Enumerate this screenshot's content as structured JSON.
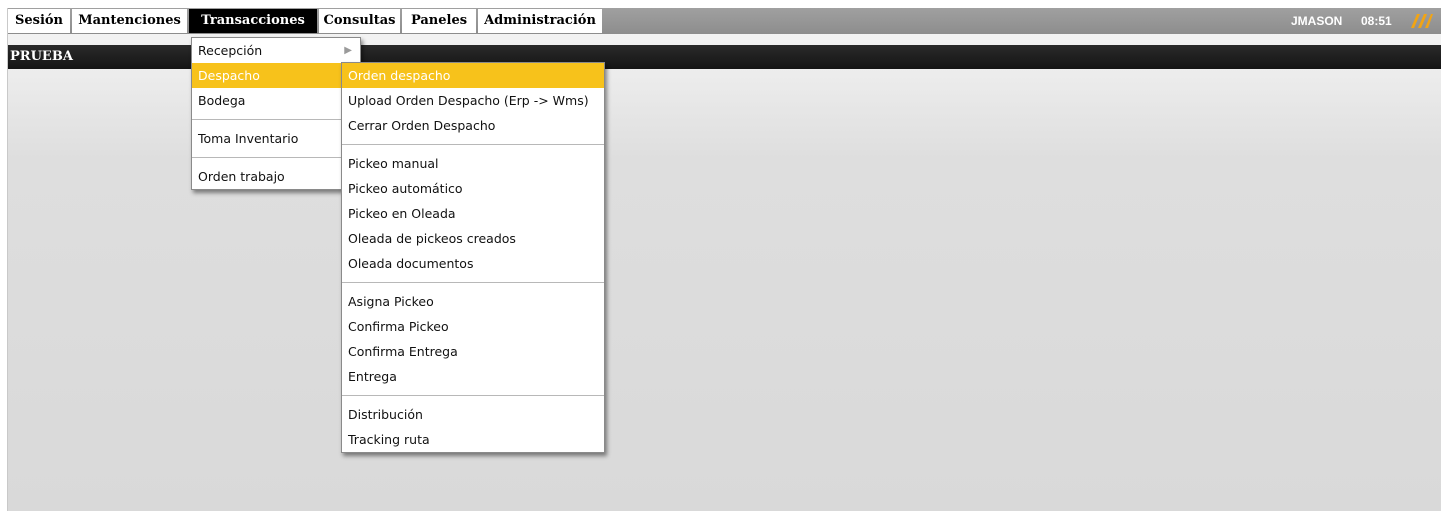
{
  "menubar": {
    "items": [
      {
        "label": "Sesión"
      },
      {
        "label": "Mantenciones"
      },
      {
        "label": "Transacciones"
      },
      {
        "label": "Consultas"
      },
      {
        "label": "Paneles"
      },
      {
        "label": "Administración"
      }
    ],
    "active": "Transacciones",
    "user": "JMASON",
    "time": "08:51"
  },
  "titlebar": {
    "title": "PRUEBA"
  },
  "transacciones_menu": {
    "items": [
      {
        "label": "Recepción",
        "submenu": true
      },
      {
        "label": "Despacho",
        "highlighted": true
      },
      {
        "label": "Bodega"
      },
      {
        "label": "Toma Inventario"
      },
      {
        "label": "Orden trabajo"
      }
    ]
  },
  "despacho_menu": {
    "groups": [
      [
        "Orden despacho",
        "Upload Orden Despacho (Erp -> Wms)",
        "Cerrar Orden Despacho"
      ],
      [
        "Pickeo manual",
        "Pickeo automático",
        "Pickeo en Oleada",
        "Oleada de pickeos creados",
        "Oleada documentos"
      ],
      [
        "Asigna Pickeo",
        "Confirma Pickeo",
        "Confirma Entrega",
        "Entrega"
      ],
      [
        "Distribución",
        "Tracking ruta"
      ]
    ],
    "highlighted": "Orden despacho"
  },
  "colors": {
    "highlight": "#f7c21b",
    "menubar": "#939393",
    "titlebar": "#1a1a1a"
  },
  "icons": {
    "logo": "brand-slash-logo",
    "submenu_arrow": "chevron-right-icon"
  }
}
